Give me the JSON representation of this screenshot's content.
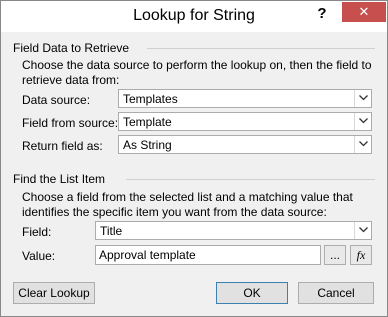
{
  "window": {
    "title": "Lookup for String",
    "help_label": "?",
    "close_label": "✕"
  },
  "retrieve": {
    "header": "Field Data to Retrieve",
    "description": "Choose the data source to perform the lookup on, then the field to retrieve data from:",
    "data_source_label": "Data source:",
    "data_source_value": "Templates",
    "field_from_source_label": "Field from source:",
    "field_from_source_value": "Template",
    "return_field_label": "Return field as:",
    "return_field_value": "As String"
  },
  "find": {
    "header": "Find the List Item",
    "description": "Choose a field from the selected list and a matching value that identifies the specific item you want from the data source:",
    "field_label": "Field:",
    "field_value": "Title",
    "value_label": "Value:",
    "value_value": "Approval template",
    "browse_label": "...",
    "formula_label": "fx"
  },
  "buttons": {
    "clear_lookup": "Clear Lookup",
    "ok": "OK",
    "cancel": "Cancel"
  },
  "icons": {
    "help": "help-icon",
    "close": "close-icon",
    "dropdown": "chevron-down-icon",
    "formula": "function-icon"
  },
  "colors": {
    "close_button": "#c7504f",
    "dialog_background": "#f0f0f0",
    "default_button_border": "#3c7fb1"
  }
}
